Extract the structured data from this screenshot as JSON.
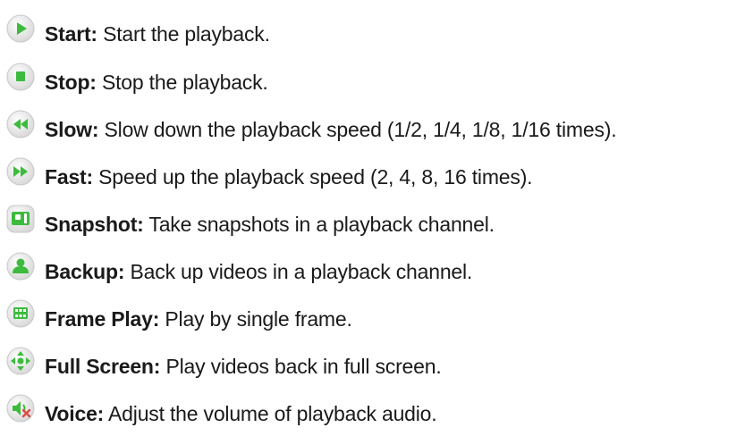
{
  "items": [
    {
      "term": "Start:",
      "description": " Start the playback.",
      "icon": "play-icon"
    },
    {
      "term": "Stop:",
      "description": " Stop the playback.",
      "icon": "stop-icon"
    },
    {
      "term": "Slow:",
      "description": " Slow down the playback speed (1/2, 1/4, 1/8, 1/16 times).",
      "icon": "rewind-icon"
    },
    {
      "term": "Fast:",
      "description": " Speed up the playback speed (2, 4, 8, 16 times).",
      "icon": "fast-forward-icon"
    },
    {
      "term": "Snapshot:",
      "description": " Take snapshots in a playback channel.",
      "icon": "snapshot-icon"
    },
    {
      "term": "Backup:",
      "description": " Back up videos in a playback channel.",
      "icon": "backup-icon"
    },
    {
      "term": "Frame Play:",
      "description": " Play by single frame.",
      "icon": "frame-play-icon"
    },
    {
      "term": "Full Screen:",
      "description": " Play videos back in full screen.",
      "icon": "full-screen-icon"
    },
    {
      "term": "Voice:",
      "description": " Adjust the volume of playback audio.",
      "icon": "voice-mute-icon"
    }
  ],
  "colors": {
    "icon_green": "#3dbb3d",
    "icon_bg": "#eeeeee",
    "mute_red": "#e04848"
  }
}
